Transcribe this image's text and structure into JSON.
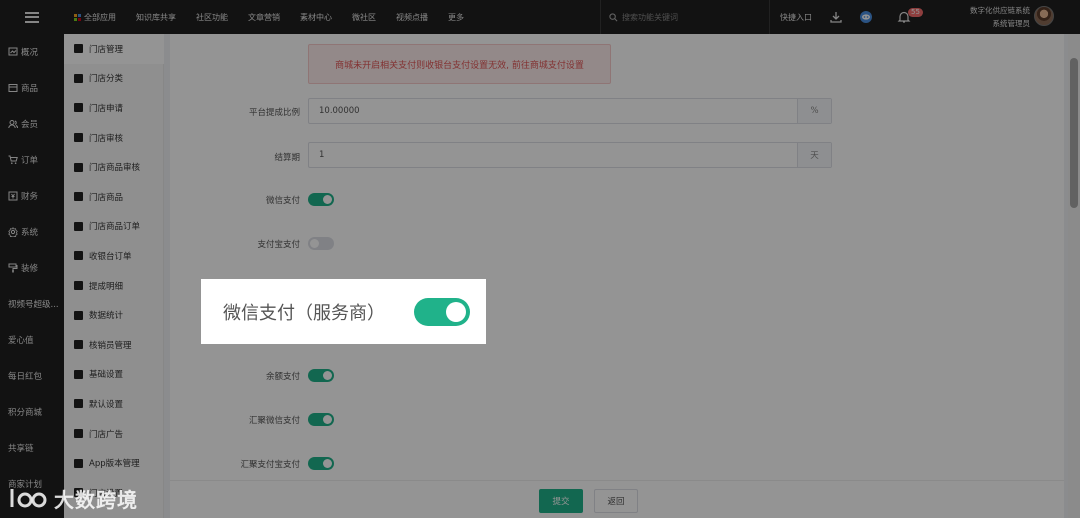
{
  "topbar": {
    "nav": [
      {
        "label": "全部应用",
        "icon": "apps-grid-icon"
      },
      {
        "label": "知识库共享"
      },
      {
        "label": "社区功能"
      },
      {
        "label": "文章营销"
      },
      {
        "label": "素材中心"
      },
      {
        "label": "微社区"
      },
      {
        "label": "视频点播"
      },
      {
        "label": "更多"
      }
    ],
    "search_placeholder": "搜索功能关键词",
    "quick_entry": "快捷入口",
    "notification_count": "55",
    "user_company": "数字化供应链系统",
    "user_role": "系统管理员"
  },
  "sidebar": {
    "items": [
      {
        "label": "概况",
        "icon": "overview-icon"
      },
      {
        "label": "商品",
        "icon": "goods-icon"
      },
      {
        "label": "会员",
        "icon": "member-icon"
      },
      {
        "label": "订单",
        "icon": "cart-icon"
      },
      {
        "label": "财务",
        "icon": "finance-icon"
      },
      {
        "label": "系统",
        "icon": "gear-icon"
      },
      {
        "label": "装修",
        "icon": "brush-icon"
      },
      {
        "label": "视频号超级..."
      },
      {
        "label": "爱心值"
      },
      {
        "label": "每日红包"
      },
      {
        "label": "积分商城"
      },
      {
        "label": "共享链"
      },
      {
        "label": "商家计划"
      }
    ]
  },
  "subsidebar": {
    "items": [
      {
        "label": "门店管理",
        "icon": "store-icon",
        "active": true
      },
      {
        "label": "门店分类",
        "icon": "category-icon"
      },
      {
        "label": "门店申请",
        "icon": "folder-icon"
      },
      {
        "label": "门店审核",
        "icon": "folder-icon"
      },
      {
        "label": "门店商品审核",
        "icon": "check-folder-icon"
      },
      {
        "label": "门店商品",
        "icon": "bag-icon"
      },
      {
        "label": "门店商品订单",
        "icon": "clipboard-icon"
      },
      {
        "label": "收银台订单",
        "icon": "receipt-icon"
      },
      {
        "label": "提成明细",
        "icon": "book-icon"
      },
      {
        "label": "数据统计",
        "icon": "chart-icon"
      },
      {
        "label": "核销员管理",
        "icon": "user-icon"
      },
      {
        "label": "基础设置",
        "icon": "gear-icon"
      },
      {
        "label": "默认设置",
        "icon": "sliders-icon"
      },
      {
        "label": "门店广告",
        "icon": "ad-icon"
      },
      {
        "label": "App版本管理",
        "icon": "gears-icon"
      },
      {
        "label": "门店设置",
        "icon": "gear-icon"
      }
    ]
  },
  "main": {
    "alert": "商城未开启相关支付则收银台支付设置无效, 前往商城支付设置",
    "commission_label": "平台提成比例",
    "commission_value": "10.00000",
    "commission_suffix": "%",
    "settlement_label": "结算期",
    "settlement_value": "1",
    "settlement_suffix": "天",
    "toggles": [
      {
        "label": "微信支付",
        "on": true
      },
      {
        "label": "支付宝支付",
        "on": false
      },
      {
        "label": "余额支付",
        "on": true
      },
      {
        "label": "汇聚微信支付",
        "on": true
      },
      {
        "label": "汇聚支付宝支付",
        "on": true
      }
    ],
    "submit": "提交",
    "back": "返回"
  },
  "highlight": {
    "label": "微信支付（服务商）",
    "on": true
  },
  "watermark": "大数跨境",
  "colors": {
    "accent": "#20b28a",
    "topbar": "#1f1f1f",
    "alert_text": "#e15555"
  }
}
